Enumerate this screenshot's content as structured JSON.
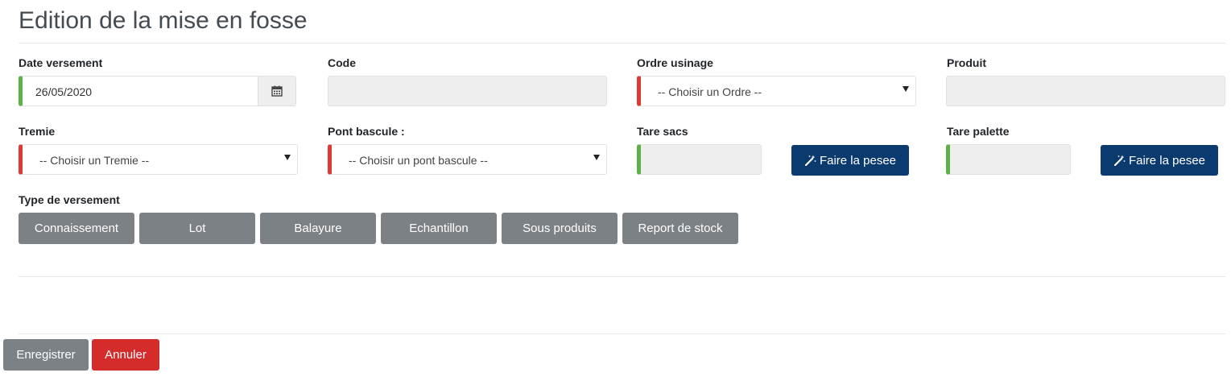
{
  "page": {
    "title": "Edition de la mise en fosse"
  },
  "fields": {
    "date_versement": {
      "label": "Date versement",
      "value": "26/05/2020"
    },
    "code": {
      "label": "Code",
      "value": ""
    },
    "ordre_usinage": {
      "label": "Ordre usinage",
      "selected": "-- Choisir un Ordre --"
    },
    "produit": {
      "label": "Produit",
      "value": ""
    },
    "tremie": {
      "label": "Tremie",
      "selected": "-- Choisir un Tremie --"
    },
    "pont_bascule": {
      "label": "Pont bascule :",
      "selected": "-- Choisir un pont bascule --"
    },
    "tare_sacs": {
      "label": "Tare sacs",
      "value": "",
      "button": "Faire la pesee"
    },
    "tare_palette": {
      "label": "Tare palette",
      "value": "",
      "button": "Faire la pesee"
    }
  },
  "type_versement": {
    "label": "Type de versement",
    "options": [
      "Connaissement",
      "Lot",
      "Balayure",
      "Echantillon",
      "Sous produits",
      "Report de stock"
    ]
  },
  "footer": {
    "save": "Enregistrer",
    "cancel": "Annuler"
  },
  "icons": {
    "calendar": "calendar-icon",
    "wand": "magic-wand-icon"
  },
  "colors": {
    "valid": "#5cb246",
    "required": "#dc3a36",
    "primary_dark": "#0b3a6e",
    "secondary": "#7c8186",
    "danger": "#d42b2b"
  }
}
